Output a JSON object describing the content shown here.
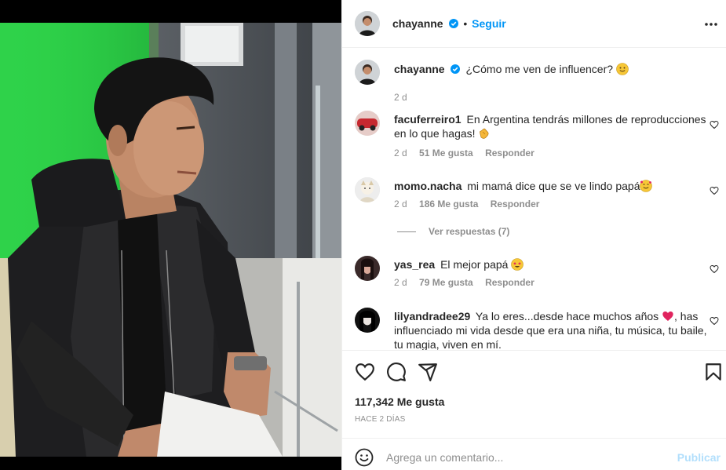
{
  "post": {
    "author": "chayanne",
    "follow_label": "Seguir",
    "caption": "¿Cómo me ven de influencer?",
    "caption_time": "2 d"
  },
  "comments": [
    {
      "user": "facuferreiro1",
      "text": "En Argentina tendrás millones de reproducciones en lo que hagas!",
      "emoji": "clapping-hands",
      "time": "2 d",
      "likes": "51 Me gusta",
      "reply": "Responder"
    },
    {
      "user": "momo.nacha",
      "text": "mi mamá dice que se ve lindo papá",
      "emoji": "smiling-face-with-hearts",
      "time": "2 d",
      "likes": "186 Me gusta",
      "reply": "Responder"
    },
    {
      "user": "yas_rea",
      "text": "El mejor papá",
      "emoji": "star-struck",
      "time": "2 d",
      "likes": "79 Me gusta",
      "reply": "Responder"
    },
    {
      "user": "lilyandradee29",
      "text_a": "Ya lo eres...desde hace muchos años",
      "text_b": ", has influenciado mi vida desde que era una niña, tu música, tu baile, tu magia, viven en mí.",
      "emoji": "red-heart"
    }
  ],
  "view_replies": "Ver respuestas (7)",
  "likes_total": "117,342 Me gusta",
  "time_ago": "HACE 2 DÍAS",
  "comment_box": {
    "placeholder": "Agrega un comentario...",
    "publish": "Publicar"
  },
  "colors": {
    "link": "#0095f6",
    "muted": "#8e8e8e",
    "publish_disabled": "#b2dffc",
    "green_screen": "#2fd24a"
  },
  "icons": [
    "more-icon",
    "verified-icon",
    "heart-icon",
    "comment-icon",
    "share-icon",
    "save-icon",
    "emoji-icon"
  ]
}
